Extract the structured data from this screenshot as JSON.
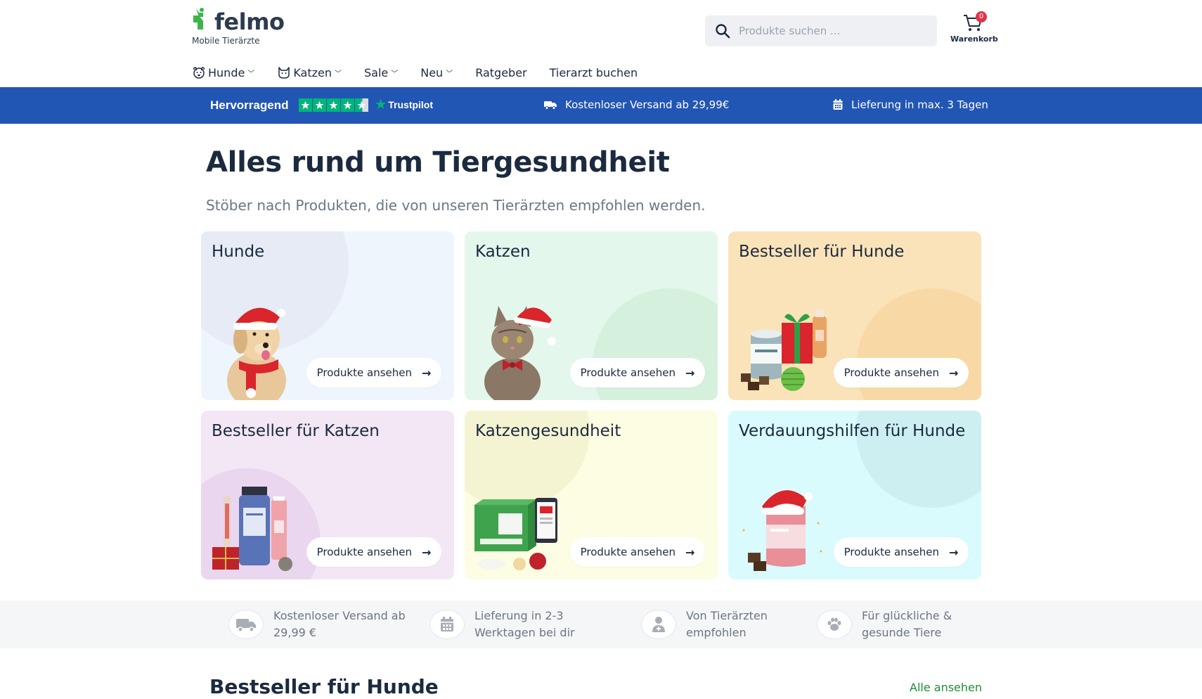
{
  "header": {
    "logo_text": "felmo",
    "logo_subtitle": "Mobile Tierärzte",
    "search_placeholder": "Produkte suchen ...",
    "cart_label": "Warenkorb",
    "cart_count": "0"
  },
  "nav": {
    "items": [
      {
        "label": "Hunde",
        "icon": "dog-face-icon",
        "dropdown": true
      },
      {
        "label": "Katzen",
        "icon": "cat-face-icon",
        "dropdown": true
      },
      {
        "label": "Sale",
        "dropdown": true
      },
      {
        "label": "Neu",
        "dropdown": true
      },
      {
        "label": "Ratgeber",
        "dropdown": false
      },
      {
        "label": "Tierarzt buchen",
        "dropdown": false
      }
    ]
  },
  "promo": {
    "rating_label": "Hervorragend",
    "trustpilot_label": "Trustpilot",
    "rating_stars": 4.5,
    "shipping": "Kostenloser Versand ab 29,99€",
    "delivery": "Lieferung in max. 3 Tagen"
  },
  "main": {
    "title": "Alles rund um Tiergesundheit",
    "subtitle": "Stöber nach Produkten, die von unseren Tierärzten empfohlen werden."
  },
  "cards": [
    {
      "title": "Hunde",
      "button": "Produkte ansehen",
      "bg": "#eff5fd",
      "blob": "#e6ebf6"
    },
    {
      "title": "Katzen",
      "button": "Produkte ansehen",
      "bg": "#e4f7ec",
      "blob": "#d6f0de"
    },
    {
      "title": "Bestseller für Hunde",
      "button": "Produkte ansehen",
      "bg": "#fbe3b9",
      "blob": "#f8d9a6"
    },
    {
      "title": "Bestseller für Katzen",
      "button": "Produkte ansehen",
      "bg": "#f3e6f5",
      "blob": "#ead6ee"
    },
    {
      "title": "Katzengesundheit",
      "button": "Produkte ansehen",
      "bg": "#fdfde3",
      "blob": "#f5f4d2"
    },
    {
      "title": "Verdauungshilfen für Hunde",
      "button": "Produkte ansehen",
      "bg": "#d9fbfd",
      "blob": "#cdeff2"
    }
  ],
  "usp": [
    {
      "text": "Kostenloser Versand ab 29,99 €",
      "icon": "truck-icon"
    },
    {
      "text": "Lieferung in 2-3 Werktagen bei dir",
      "icon": "calendar-icon"
    },
    {
      "text": "Von Tierärzten empfohlen",
      "icon": "doctor-icon"
    },
    {
      "text": "Für glückliche & gesunde Tiere",
      "icon": "paw-icon"
    }
  ],
  "bestseller": {
    "title": "Bestseller für Hunde",
    "link": "Alle ansehen"
  },
  "colors": {
    "promo_bg": "#2256b4",
    "brand_green": "#3cb54a",
    "link_green": "#1f8d36",
    "trustpilot_green": "#00b67a",
    "text_dark": "#1b2a3f",
    "text_muted": "#6b7685"
  }
}
